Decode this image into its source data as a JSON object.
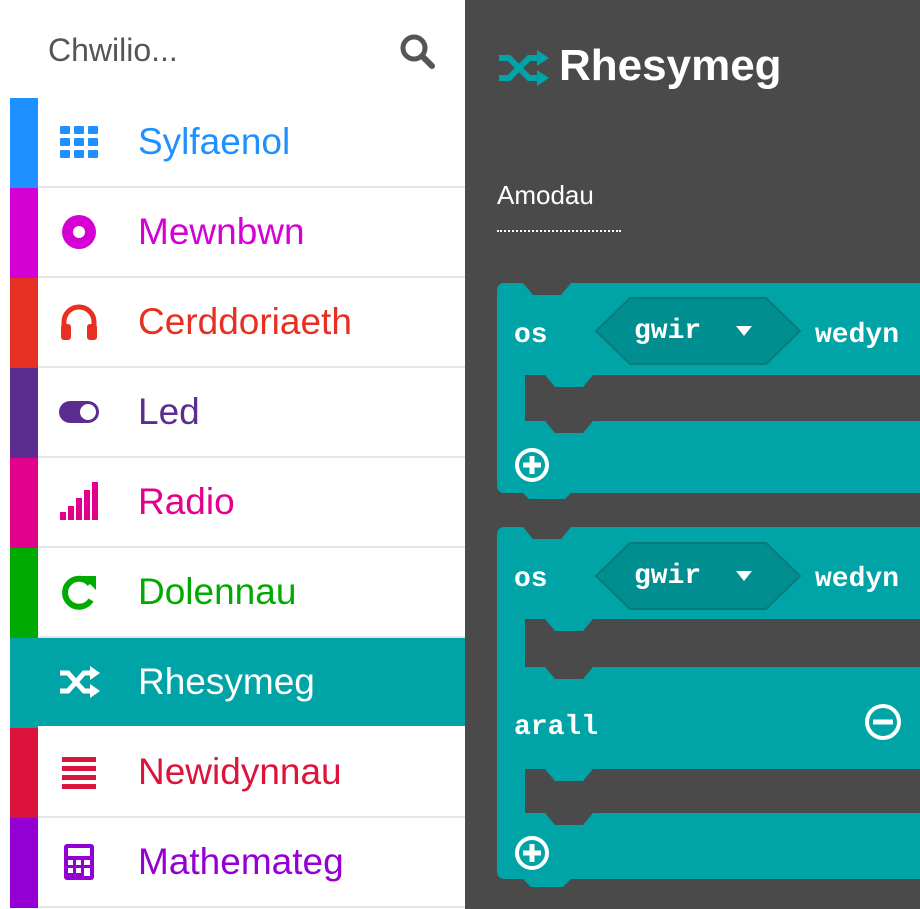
{
  "search": {
    "placeholder": "Chwilio..."
  },
  "categories": [
    {
      "label": "Sylfaenol",
      "color": "#1e90ff",
      "icon": "grid-icon"
    },
    {
      "label": "Mewnbwn",
      "color": "#d400d4",
      "icon": "record-icon"
    },
    {
      "label": "Cerddoriaeth",
      "color": "#e63022",
      "icon": "headphones-icon"
    },
    {
      "label": "Led",
      "color": "#5c2d91",
      "icon": "toggle-icon"
    },
    {
      "label": "Radio",
      "color": "#e3008c",
      "icon": "signal-icon"
    },
    {
      "label": "Dolennau",
      "color": "#00aa00",
      "icon": "loop-icon"
    },
    {
      "label": "Rhesymeg",
      "color": "#00a4a6",
      "icon": "shuffle-icon",
      "selected": true
    },
    {
      "label": "Newidynnau",
      "color": "#dc143c",
      "icon": "list-icon"
    },
    {
      "label": "Mathemateg",
      "color": "#9400d3",
      "icon": "calculator-icon"
    }
  ],
  "flyout": {
    "title": "Rhesymeg",
    "section": "Amodau",
    "block_color": "#00a4a6",
    "blocks": [
      {
        "if_label": "os",
        "condition": "gwir",
        "then_label": "wedyn"
      },
      {
        "if_label": "os",
        "condition": "gwir",
        "then_label": "wedyn",
        "else_label": "arall"
      }
    ]
  }
}
